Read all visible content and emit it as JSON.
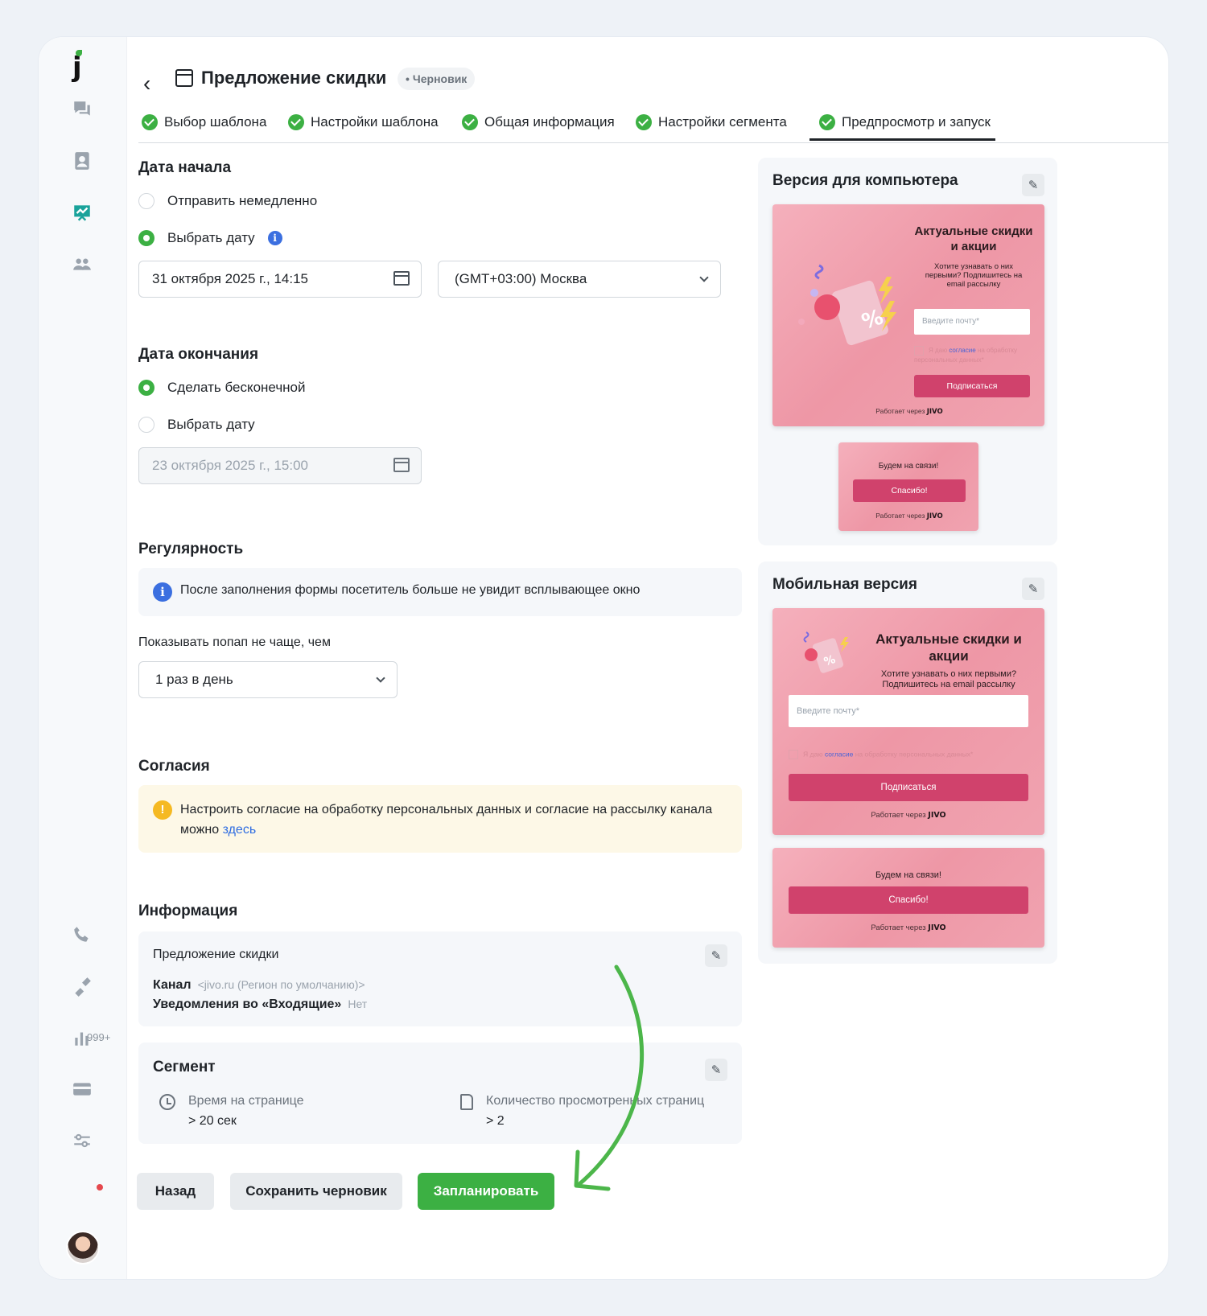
{
  "header": {
    "back_label": "‹",
    "title": "Предложение скидки",
    "status": "Черновик"
  },
  "steps": [
    {
      "label": "Выбор шаблона"
    },
    {
      "label": "Настройки шаблона"
    },
    {
      "label": "Общая информация"
    },
    {
      "label": "Настройки сегмента"
    },
    {
      "label": "Предпросмотр и запуск"
    }
  ],
  "start": {
    "title": "Дата начала",
    "opt_now": "Отправить немедленно",
    "opt_date": "Выбрать дату",
    "selected": "Выбрать дату",
    "date_value": "31 октября 2025 г., 14:15",
    "timezone": "(GMT+03:00) Москва"
  },
  "end": {
    "title": "Дата окончания",
    "opt_infinite": "Сделать бесконечной",
    "opt_date": "Выбрать дату",
    "selected": "Сделать бесконечной",
    "date_placeholder": "23 октября 2025 г., 15:00"
  },
  "regularity": {
    "title": "Регулярность",
    "note": "После заполнения формы посетитель больше не увидит всплывающее окно",
    "freq_label": "Показывать попап не чаще, чем",
    "freq_value": "1 раз в день"
  },
  "consents": {
    "title": "Согласия",
    "note": "Настроить согласие на обработку персональных данных и согласие на рассылку канала можно ",
    "link": "здесь"
  },
  "info": {
    "title": "Информация",
    "name": "Предложение скидки",
    "channel_label": "Канал",
    "channel_value": "<jivo.ru (Регион по умолчанию)>",
    "inbox_label": "Уведомления во «Входящие»",
    "inbox_value": "Нет"
  },
  "segment": {
    "title": "Сегмент",
    "time_label": "Время на странице",
    "time_value": "> 20 сек",
    "pages_label": "Количество просмотренных страниц",
    "pages_value": "> 2"
  },
  "actions": {
    "back": "Назад",
    "save": "Сохранить черновик",
    "schedule": "Запланировать"
  },
  "sidebar": {
    "logo": "j",
    "badge": "999+"
  },
  "preview_desktop": {
    "title": "Версия для компьютера",
    "heading": "Актуальные скидки и акции",
    "text": "Хотите узнавать о них первыми? Подпишитесь на email рассылку",
    "input_placeholder": "Введите почту*",
    "consent_prefix": "Я даю ",
    "consent_link": "согласие",
    "consent_suffix": " на обработку персональных данных*",
    "button": "Подписаться",
    "powered": "Работает через",
    "brand": "JIVO",
    "thanks_title": "Будем на связи!",
    "thanks_button": "Спасибо!"
  },
  "preview_mobile": {
    "title": "Мобильная версия",
    "heading": "Актуальные скидки и акции",
    "text": "Хотите узнавать о них первыми? Подпишитесь на email рассылку",
    "input_placeholder": "Введите почту*",
    "consent_prefix": "Я даю ",
    "consent_link": "согласие",
    "consent_suffix": " на обработку персональных данных*",
    "button": "Подписаться",
    "powered": "Работает через",
    "brand": "JIVO",
    "thanks_title": "Будем на связи!",
    "thanks_button": "Спасибо!"
  },
  "colors": {
    "accent_green": "#3cb043",
    "link_blue": "#2f6de1",
    "popup_button": "#d0426c",
    "arrow": "#4cb64a"
  }
}
